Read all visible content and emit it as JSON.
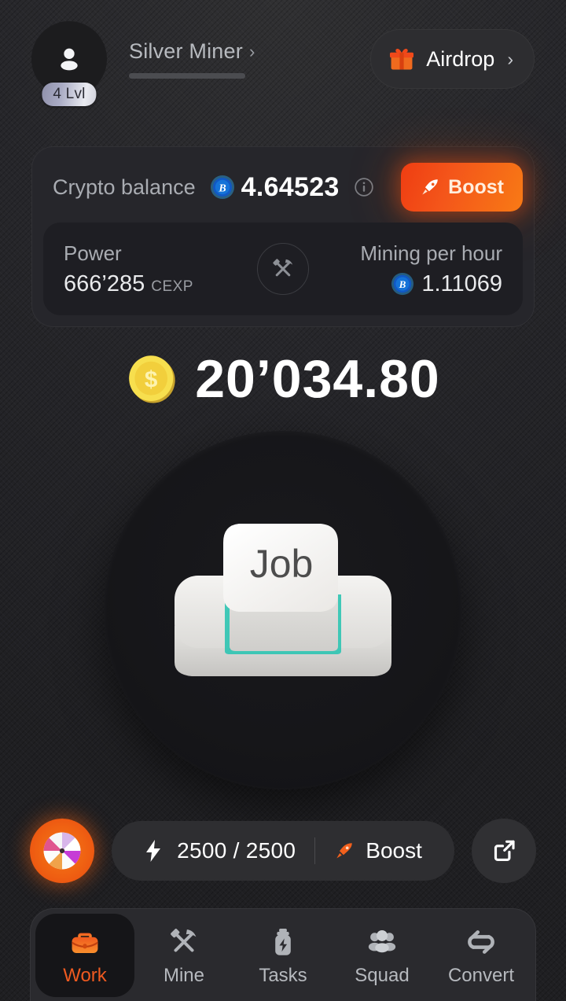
{
  "header": {
    "avatar_icon": "person-icon",
    "level_badge": "4 Lvl",
    "rank_name": "Silver Miner",
    "rank_chevron": "›",
    "airdrop": {
      "icon": "gift-icon",
      "label": "Airdrop",
      "chevron": "›"
    }
  },
  "balance_card": {
    "label": "Crypto balance",
    "currency_icon": "bitcoin-icon",
    "value": "4.64523",
    "info_icon": "info-icon",
    "boost": {
      "icon": "rocket-icon",
      "label": "Boost"
    },
    "center_icon": "hammer-pickaxe-icon",
    "power": {
      "label": "Power",
      "value": "666’285",
      "unit": "CEXP"
    },
    "mining": {
      "label": "Mining per hour",
      "currency_icon": "bitcoin-icon",
      "value": "1.11069"
    }
  },
  "counter": {
    "coin_icon": "gold-coin-icon",
    "amount": "20’034.80"
  },
  "tap_button": {
    "icon": "keycap-job-icon",
    "keycap_label": "Job"
  },
  "energy_row": {
    "wheel_icon": "fortune-wheel-icon",
    "bolt_icon": "lightning-bolt-icon",
    "energy": "2500 / 2500",
    "boost": {
      "icon": "rocket-icon",
      "label": "Boost"
    },
    "share_icon": "external-link-icon"
  },
  "nav": {
    "items": [
      {
        "icon": "briefcase-icon",
        "label": "Work",
        "active": true
      },
      {
        "icon": "hammer-pickaxe-icon",
        "label": "Mine",
        "active": false
      },
      {
        "icon": "energy-jar-icon",
        "label": "Tasks",
        "active": false
      },
      {
        "icon": "people-icon",
        "label": "Squad",
        "active": false
      },
      {
        "icon": "swap-arrows-icon",
        "label": "Convert",
        "active": false
      }
    ]
  },
  "colors": {
    "background": "#28282a",
    "card": "#26262b",
    "card_inner": "#1e1e23",
    "accent_orange": "#ef5a20",
    "boost_gradient_from": "#ef3d12",
    "boost_gradient_to": "#f87a15",
    "bitcoin_blue": "#1b7fe0",
    "text_primary": "#ffffff",
    "text_muted": "#a9acb2",
    "coin_yellow": "#f4d13c"
  }
}
